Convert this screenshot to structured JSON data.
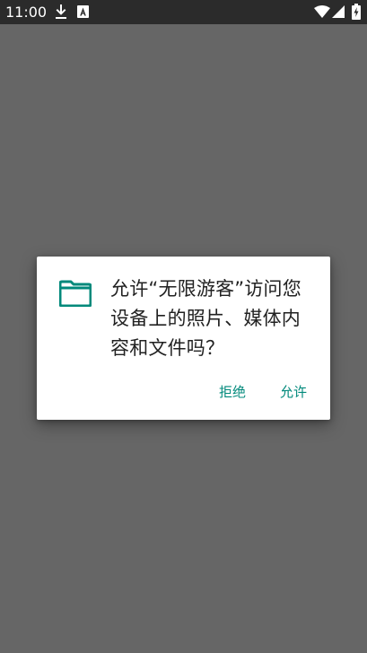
{
  "status_bar": {
    "time": "11:00",
    "left_icons": [
      "download-icon",
      "app-notification-icon"
    ],
    "right_icons": [
      "wifi-icon",
      "cellular-signal-icon",
      "battery-charging-icon"
    ],
    "background": "#2b2b2b"
  },
  "scrim_color": "#666666",
  "dialog": {
    "icon": "folder-icon",
    "message": "允许“无限游客”访问您设备上的照片、媒体内容和文件吗？",
    "deny_label": "拒绝",
    "allow_label": "允许",
    "accent_color": "#00897b"
  }
}
